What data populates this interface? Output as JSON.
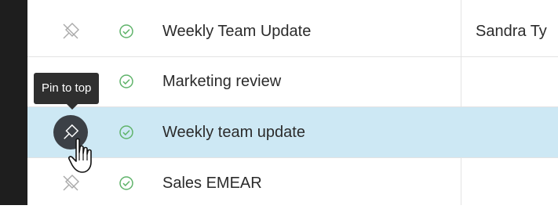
{
  "tooltip": {
    "text": "Pin to top"
  },
  "rows": [
    {
      "title": "Weekly Team Update",
      "host": "Sandra Ty",
      "pin_state": "unpinned",
      "status_icon": "check-circle-icon"
    },
    {
      "title": "Marketing review",
      "host": "",
      "pin_state": "unpinned",
      "status_icon": "check-circle-icon"
    },
    {
      "title": "Weekly team update",
      "host": "",
      "pin_state": "hover-pin",
      "status_icon": "check-circle-icon",
      "selected": true
    },
    {
      "title": "Sales EMEAR",
      "host": "",
      "pin_state": "unpinned",
      "status_icon": "check-circle-icon"
    }
  ],
  "colors": {
    "selected_row": "#cde8f4",
    "check": "#5fb36a",
    "pin_hover_bg": "#3c4046",
    "left_rail": "#1e1e1e"
  }
}
